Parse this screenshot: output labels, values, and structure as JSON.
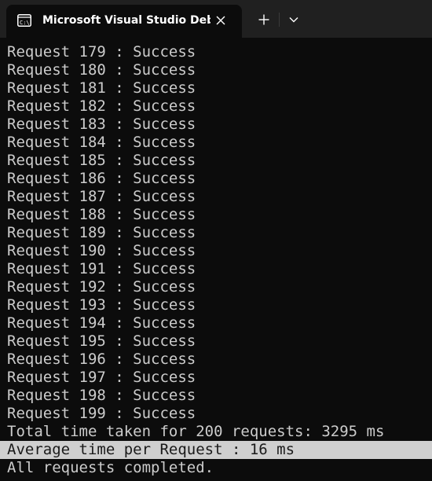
{
  "window": {
    "tab_title": "Microsoft Visual Studio Debug Console",
    "icons": {
      "tab": "console-app-icon",
      "close": "close-icon",
      "new_tab": "plus-icon",
      "dropdown": "chevron-down-icon"
    }
  },
  "colors": {
    "titlebar": "#202020",
    "terminal_background": "#0c0c0c",
    "terminal_text": "#cccccc",
    "selection_background": "#cfcfcf"
  },
  "console": {
    "lines": [
      "Request 179 : Success",
      "Request 180 : Success",
      "Request 181 : Success",
      "Request 182 : Success",
      "Request 183 : Success",
      "Request 184 : Success",
      "Request 185 : Success",
      "Request 186 : Success",
      "Request 187 : Success",
      "Request 188 : Success",
      "Request 189 : Success",
      "Request 190 : Success",
      "Request 191 : Success",
      "Request 192 : Success",
      "Request 193 : Success",
      "Request 194 : Success",
      "Request 195 : Success",
      "Request 196 : Success",
      "Request 197 : Success",
      "Request 198 : Success",
      "Request 199 : Success",
      "Total time taken for 200 requests: 3295 ms",
      "Average time per Request : 16 ms",
      "All requests completed."
    ],
    "selected_line_text": "Average time per Request : 16 ms"
  }
}
